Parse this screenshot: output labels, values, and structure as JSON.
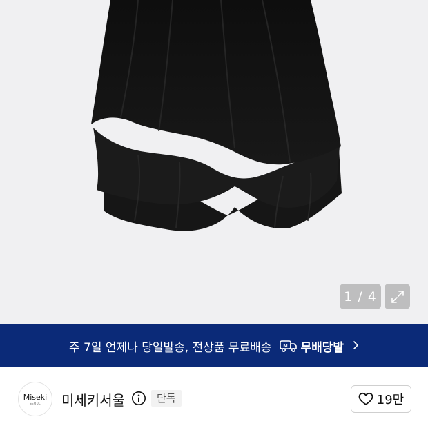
{
  "gallery": {
    "counter_text": "1 / 4",
    "expand_icon": "expand-arrows-icon"
  },
  "promo": {
    "text": "주 7일 언제나 당일발송, 전상품 무료배송",
    "free_shipping_label": "무배당발",
    "badge_letter": "M",
    "color": "#0b2a78"
  },
  "seller": {
    "logo_text": "Miseki",
    "logo_subtext": "SEOUL",
    "name": "미세키서울",
    "exclusive_badge": "단독"
  },
  "like": {
    "count": "19만",
    "icon": "heart-outline-icon"
  }
}
